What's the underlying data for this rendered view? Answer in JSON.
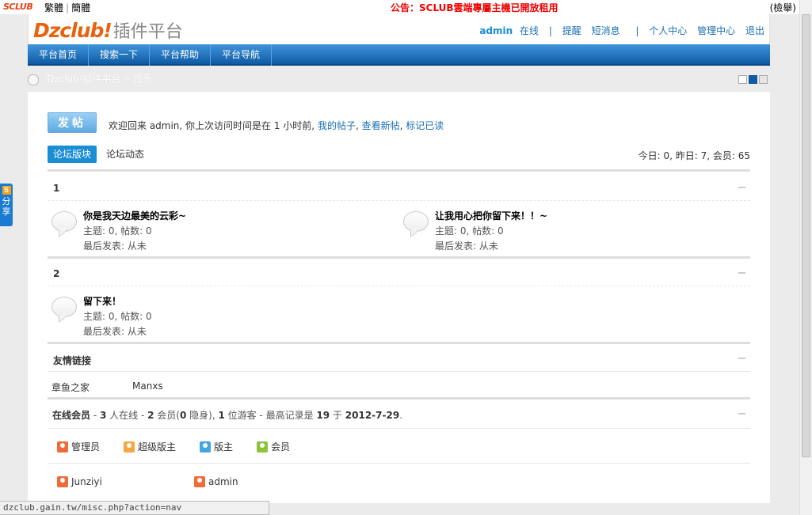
{
  "topbar": {
    "logo": "SCLUB",
    "lang_trad": "繁體",
    "lang_simp": "簡體",
    "notice": "公告：SCLUB雲端專屬主機已開放租用",
    "search": "(檢舉)"
  },
  "header": {
    "brand_main": "Dzclub!",
    "brand_sub": "插件平台",
    "username": "admin",
    "online": "在线",
    "remind": "提醒",
    "pm": "短消息",
    "profile": "个人中心",
    "admincp": "管理中心",
    "logout": "退出"
  },
  "nav": [
    "平台首页",
    "搜索一下",
    "平台帮助",
    "平台导航"
  ],
  "breadcrumb": "Dzclub!插件平台 » 首页",
  "share": "分享",
  "main": {
    "post_button": "发帖",
    "welcome_prefix": "欢迎回来 admin, 你上次访问时间是在 1 小时前, ",
    "my_posts": "我的帖子",
    "new_posts": "查看新帖",
    "mark_read": "标记已读",
    "tab_forums": "论坛版块",
    "tab_feed": "论坛动态",
    "stats": "今日: 0, 昨日: 7, 会员: 65"
  },
  "sections": [
    {
      "title": "1",
      "forums": [
        {
          "name": "你是我天边最美的云彩~",
          "counts": "主题: 0, 帖数: 0",
          "last": "最后发表: 从未"
        },
        {
          "name": "让我用心把你留下来！！~",
          "counts": "主题: 0, 帖数: 0",
          "last": "最后发表: 从未"
        }
      ]
    },
    {
      "title": "2",
      "forums": [
        {
          "name": "留下来！",
          "counts": "主题: 0, 帖数: 0",
          "last": "最后发表: 从未"
        }
      ]
    }
  ],
  "links": {
    "title": "友情链接",
    "items": [
      "章鱼之家",
      "Manxs"
    ]
  },
  "online": {
    "title": "在线会员",
    "summary_1": " - ",
    "total": "3",
    "summary_2": " 人在线 - ",
    "members": "2",
    "summary_3": " 会员(",
    "hidden": "0",
    "summary_4": " 隐身), ",
    "guests": "1",
    "summary_5": " 位游客 - 最高记录是 ",
    "record": "19",
    "summary_6": " 于 ",
    "record_date": "2012-7-29",
    "summary_7": ".",
    "legend": [
      "管理员",
      "超级版主",
      "版主",
      "会员"
    ],
    "users": [
      "Junziyi",
      "admin"
    ]
  },
  "statusbar": "dzclub.gain.tw/misc.php?action=nav"
}
